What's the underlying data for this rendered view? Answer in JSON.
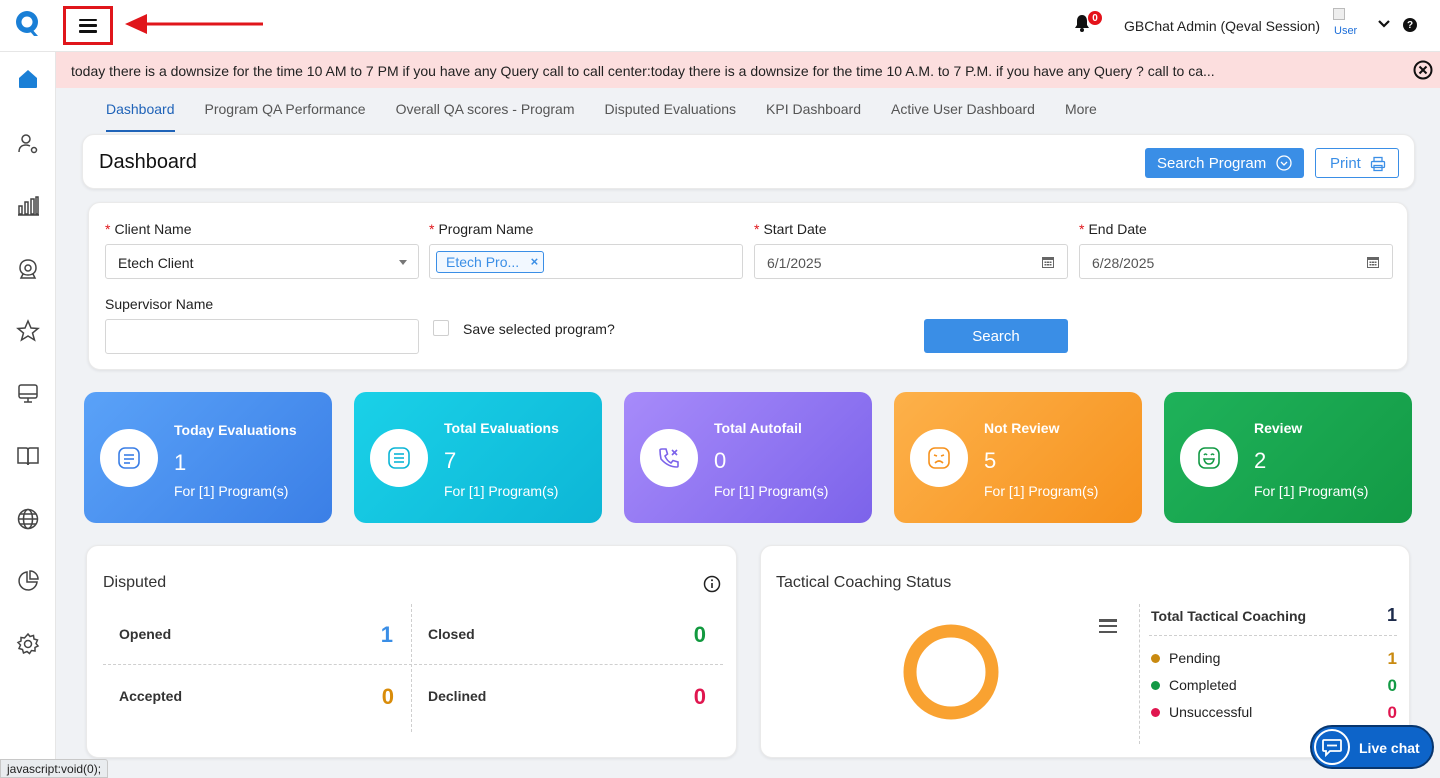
{
  "header": {
    "user_name": "GBChat Admin (Qeval Session)",
    "avatar_alt": "User",
    "notifications_count": "0",
    "help": "?"
  },
  "banner": {
    "text": "today there is a downsize for the time 10 AM to 7 PM if you have any Query call to call center:today there is a downsize for the time 10 A.M. to 7 P.M. if you have any Query ? call to ca..."
  },
  "tabs": [
    {
      "label": "Dashboard",
      "active": true
    },
    {
      "label": "Program QA Performance"
    },
    {
      "label": "Overall QA scores - Program"
    },
    {
      "label": "Disputed Evaluations"
    },
    {
      "label": "KPI Dashboard"
    },
    {
      "label": "Active User Dashboard"
    },
    {
      "label": "More"
    }
  ],
  "dashboard": {
    "title": "Dashboard",
    "search_program_label": "Search Program",
    "print_label": "Print"
  },
  "filters": {
    "client_name_label": "Client Name",
    "client_name_value": "Etech Client",
    "program_name_label": "Program Name",
    "program_tag": "Etech Pro...",
    "program_tag_remove": "×",
    "start_date_label": "Start Date",
    "start_date_value": "6/1/2025",
    "end_date_label": "End Date",
    "end_date_value": "6/28/2025",
    "supervisor_label": "Supervisor Name",
    "supervisor_value": "",
    "save_program_label": "Save selected program?",
    "search_button": "Search",
    "required_mark": "*"
  },
  "stats": [
    {
      "title": "Today Evaluations",
      "value": "1",
      "sub": "For [1] Program(s)",
      "color_from": "#5aa2f8",
      "color_to": "#3b7fe6",
      "icon": "list-icon"
    },
    {
      "title": "Total Evaluations",
      "value": "7",
      "sub": "For [1] Program(s)",
      "color_from": "#1ad1e8",
      "color_to": "#0db6d6",
      "icon": "document-list-icon"
    },
    {
      "title": "Total Autofail",
      "value": "0",
      "sub": "For [1] Program(s)",
      "color_from": "#a78bfa",
      "color_to": "#7c63ea",
      "icon": "phone-missed-icon"
    },
    {
      "title": "Not Review",
      "value": "5",
      "sub": "For [1] Program(s)",
      "color_from": "#fdb14a",
      "color_to": "#f6921e",
      "icon": "sad-face-icon"
    },
    {
      "title": "Review",
      "value": "2",
      "sub": "For [1] Program(s)",
      "color_from": "#1fb25a",
      "color_to": "#139a45",
      "icon": "happy-face-icon"
    }
  ],
  "disputed": {
    "title": "Disputed",
    "opened_label": "Opened",
    "opened_value": "1",
    "opened_color": "#3a8ee6",
    "closed_label": "Closed",
    "closed_value": "0",
    "closed_color": "#12993f",
    "accepted_label": "Accepted",
    "accepted_value": "0",
    "accepted_color": "#d98c0a",
    "declined_label": "Declined",
    "declined_value": "0",
    "declined_color": "#e0164f"
  },
  "tactical": {
    "title": "Tactical Coaching Status",
    "total_label": "Total Tactical Coaching",
    "total_value": "1",
    "pending_label": "Pending",
    "pending_value": "1",
    "pending_color": "#c98a10",
    "completed_label": "Completed",
    "completed_value": "0",
    "completed_color": "#139a45",
    "unsuccessful_label": "Unsuccessful",
    "unsuccessful_value": "0",
    "unsuccessful_color": "#e0164f",
    "donut_color": "#f9a231"
  },
  "livechat": {
    "label": "Live chat"
  },
  "statusbar": {
    "text": "javascript:void(0);"
  }
}
